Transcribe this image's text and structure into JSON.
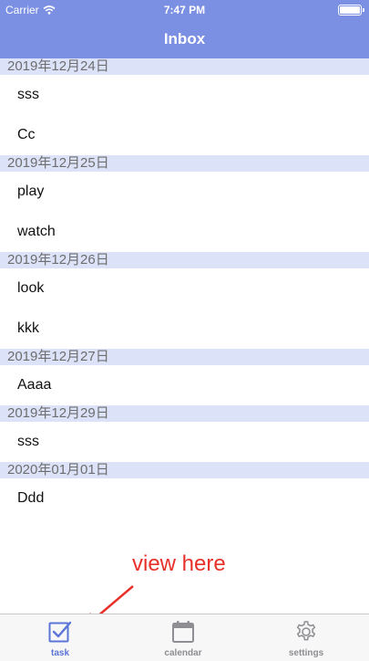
{
  "status_bar": {
    "carrier": "Carrier",
    "time": "7:47 PM"
  },
  "nav": {
    "title": "Inbox"
  },
  "sections": [
    {
      "date": "2019年12月24日",
      "items": [
        "sss",
        "Cc"
      ]
    },
    {
      "date": "2019年12月25日",
      "items": [
        "play",
        "watch"
      ]
    },
    {
      "date": "2019年12月26日",
      "items": [
        "look",
        "kkk"
      ]
    },
    {
      "date": "2019年12月27日",
      "items": [
        "Aaaa"
      ]
    },
    {
      "date": "2019年12月29日",
      "items": [
        "sss"
      ]
    },
    {
      "date": "2020年01月01日",
      "items": [
        "Ddd"
      ]
    }
  ],
  "annotation": {
    "text": "view here"
  },
  "tabs": [
    {
      "label": "task",
      "icon": "checkbox-icon",
      "selected": true
    },
    {
      "label": "calendar",
      "icon": "calendar-icon",
      "selected": false
    },
    {
      "label": "settings",
      "icon": "gear-icon",
      "selected": false
    }
  ],
  "colors": {
    "accent": "#7b8fe3",
    "section_bg": "#dce2f8",
    "tab_selected": "#5b74d8",
    "tab_unselected": "#8e8e93",
    "annotation": "#e8302a"
  }
}
